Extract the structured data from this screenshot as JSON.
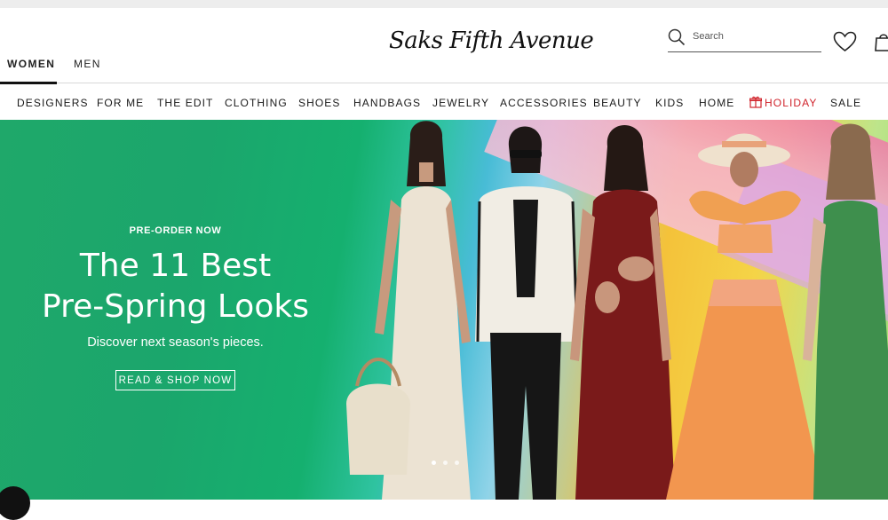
{
  "header": {
    "logo_text": "Saks Fifth Avenue",
    "gender_tabs": [
      "WOMEN",
      "MEN"
    ],
    "active_gender": "WOMEN",
    "search": {
      "placeholder": "Search",
      "value": ""
    },
    "icons": [
      "search-icon",
      "heart-icon",
      "shopping-bag-icon"
    ]
  },
  "nav": {
    "items": [
      "DESIGNERS",
      "FOR ME",
      "THE EDIT",
      "CLOTHING",
      "SHOES",
      "HANDBAGS",
      "JEWELRY",
      "ACCESSORIES",
      "BEAUTY",
      "KIDS",
      "HOME",
      "HOLIDAY",
      "SALE"
    ],
    "highlight_item": "HOLIDAY",
    "highlight_color": "#d0232b"
  },
  "hero": {
    "eyebrow": "PRE-ORDER NOW",
    "headline_line1": "The 11 Best",
    "headline_line2": "Pre-Spring Looks",
    "subhead": "Discover next season's pieces.",
    "cta_label": "READ & SHOP NOW",
    "carousel": {
      "slides": 3,
      "active_index": 0
    }
  },
  "colors": {
    "accent_red": "#d0232b",
    "hero_green": "#1ba66c",
    "text": "#111111"
  }
}
